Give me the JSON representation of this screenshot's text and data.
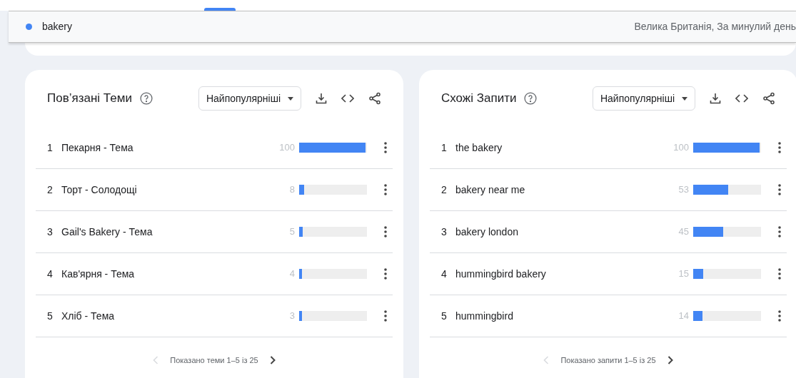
{
  "search_term": {
    "label": "bakery",
    "color": "#4285f4"
  },
  "region_period": "Велика Британія, За минулий день",
  "panels": [
    {
      "title": "Пов’язані Теми",
      "sort": "Найпопулярніші",
      "rows": [
        {
          "rank": "1",
          "label": "Пекарня - Тема",
          "value": "100",
          "level": 1
        },
        {
          "rank": "2",
          "label": "Торт - Солодощі",
          "value": "8",
          "level": 0.08
        },
        {
          "rank": "3",
          "label": "Gail's Bakery - Тема",
          "value": "5",
          "level": 0.05
        },
        {
          "rank": "4",
          "label": "Кав'ярня - Тема",
          "value": "4",
          "level": 0.04
        },
        {
          "rank": "5",
          "label": "Хліб - Тема",
          "value": "3",
          "level": 0.03
        }
      ],
      "pager": {
        "text": "Показано теми 1–5 із 25",
        "prev_disabled": true,
        "next_disabled": false
      }
    },
    {
      "title": "Схожі Запити",
      "sort": "Найпопулярніші",
      "rows": [
        {
          "rank": "1",
          "label": "the bakery",
          "value": "100",
          "level": 1
        },
        {
          "rank": "2",
          "label": "bakery near me",
          "value": "53",
          "level": 0.53
        },
        {
          "rank": "3",
          "label": "bakery london",
          "value": "45",
          "level": 0.45
        },
        {
          "rank": "4",
          "label": "hummingbird bakery",
          "value": "15",
          "level": 0.15
        },
        {
          "rank": "5",
          "label": "hummingbird",
          "value": "14",
          "level": 0.14
        }
      ],
      "pager": {
        "text": "Показано запити 1–5 із 25",
        "prev_disabled": true,
        "next_disabled": false
      }
    }
  ]
}
